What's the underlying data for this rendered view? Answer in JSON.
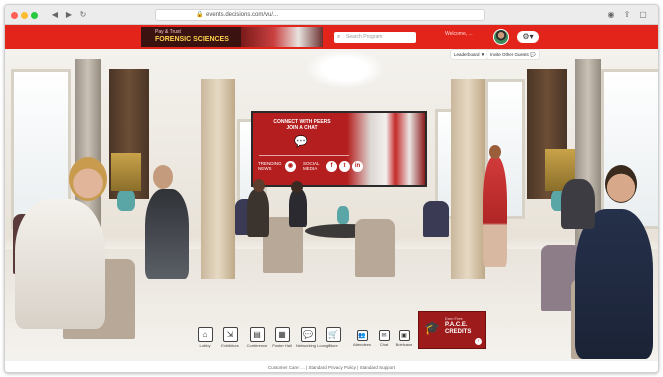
{
  "browser": {
    "url": "events.decisions.com/vu/...",
    "back_icon": "◀",
    "forward_icon": "▶",
    "reload_icon": "↻"
  },
  "header": {
    "brand_small": "Pay & Trust",
    "brand_title": "FORENSIC SCIENCES",
    "search_placeholder": "Search Program",
    "welcome": "Welcome, ...",
    "settings_icon": "gear-icon"
  },
  "right_controls": {
    "leaderboard_label": "Leaderboard",
    "chat_label": "Invite Other Guests"
  },
  "promo": {
    "line1": "CONNECT WITH PEERS",
    "line2": "JOIN A CHAT",
    "trending_label": "TRENDING NEWS",
    "social_label": "SOCIAL MEDIA",
    "social_icons": [
      "f",
      "t",
      "in"
    ],
    "brand_color": "#b51e1e"
  },
  "bottom_nav": {
    "items": [
      {
        "label": "Lobby",
        "icon": "⌂"
      },
      {
        "label": "Exhibitors",
        "icon": "⇲"
      },
      {
        "label": "Conference",
        "icon": "▤"
      },
      {
        "label": "Poster Hall",
        "icon": "▦"
      },
      {
        "label": "Networking Lounge",
        "icon": "💬"
      },
      {
        "label": "Store",
        "icon": "🛒"
      }
    ],
    "small_items": [
      {
        "label": "Attendees",
        "icon": "👥"
      },
      {
        "label": "Chat",
        "icon": "✉"
      },
      {
        "label": "Briefcase",
        "icon": "▣"
      }
    ]
  },
  "pace": {
    "small": "Earn Free",
    "title": "P.A.C.E.",
    "subtitle": "CREDITS",
    "arrow": "›"
  },
  "footer": {
    "text": "Customer Care: ...   |   Standard Privacy Policy   |   Standard Support"
  }
}
